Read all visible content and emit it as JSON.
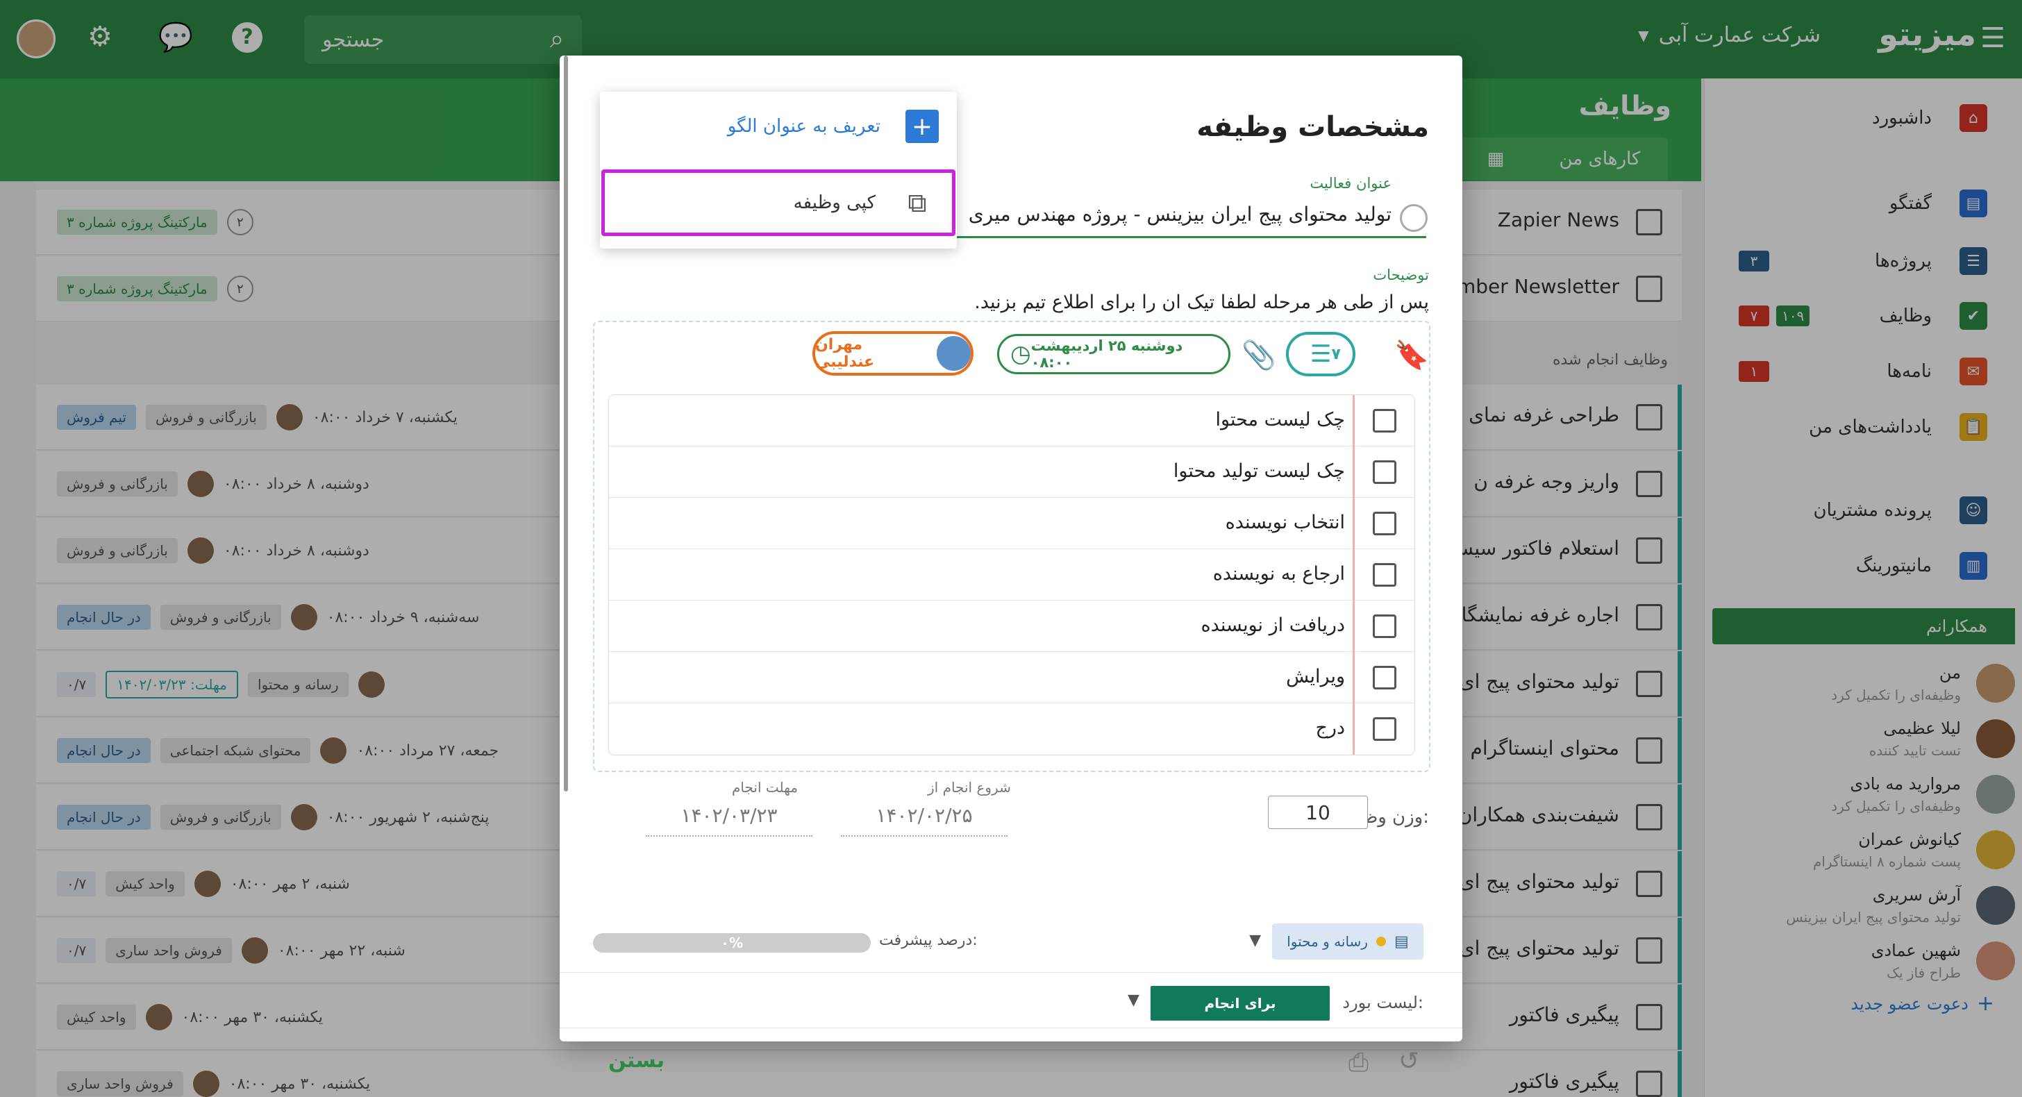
{
  "topbar": {
    "brand": "میزیتو",
    "company": "شرکت عمارت آبی",
    "search_placeholder": "جستجو"
  },
  "page": {
    "title": "وظایف",
    "tab_my_tasks": "کارهای من",
    "done_tasks_label": "وظایف انجام شده"
  },
  "sidebar": {
    "items": [
      {
        "label": "داشبورد",
        "icon": "home-icon",
        "color": "#d8352a"
      },
      {
        "label": "گفتگو",
        "icon": "chat-icon",
        "color": "#2b6cd1"
      },
      {
        "label": "پروژه‌ها",
        "icon": "project-icon",
        "color": "#2d5f8c",
        "badge": "۳"
      },
      {
        "label": "وظایف",
        "icon": "task-check-icon",
        "color": "#2e8b45",
        "badge_red": "۷",
        "badge_green": "۱۰۹"
      },
      {
        "label": "نامه‌ها",
        "icon": "mail-icon",
        "color": "#e8542a",
        "badge_red": "۱"
      },
      {
        "label": "یادداشت‌های من",
        "icon": "clipboard-icon",
        "color": "#e8b21d"
      },
      {
        "label": "پرونده مشتریان",
        "icon": "contact-icon",
        "color": "#2d5f8c"
      },
      {
        "label": "مانیتورینگ",
        "icon": "chart-icon",
        "color": "#2b6cd1"
      }
    ],
    "team_header": "همکارانم",
    "members": [
      {
        "name": "من",
        "status": "وظیفه‌ای را تکمیل کرد"
      },
      {
        "name": "لیلا عظیمی",
        "status": "تست تایید کننده"
      },
      {
        "name": "مروارید مه بادی",
        "status": "وظیفه‌ای را تکمیل کرد"
      },
      {
        "name": "کیانوش عمران",
        "status": "پست شماره ۸ اینستاگرام"
      },
      {
        "name": "آرش سریری",
        "status": "تولید محتوای پیج ایران بیزینس"
      },
      {
        "name": "شهین عمادی",
        "status": "طراح فاز یک"
      }
    ],
    "invite": "دعوت عضو جدید"
  },
  "rows": [
    {
      "title": "Zapier News",
      "tag": "مارکتینگ پروژه شماره ۳",
      "count": "۲"
    },
    {
      "title": "ember Newsletter",
      "tag": "مارکتینگ پروژه شماره ۳",
      "count": "۲"
    },
    {
      "title": "طراحی غرفه نمای",
      "team": "تیم فروش",
      "board": "بازرگانی و فروش",
      "date": "یکشنبه، ۷ خرداد ۰۸:۰۰"
    },
    {
      "title": "واریز وجه غرفه ن",
      "board": "بازرگانی و فروش",
      "date": "دوشنبه، ۸ خرداد ۰۸:۰۰"
    },
    {
      "title": "استعلام فاکتور سیس",
      "board": "بازرگانی و فروش",
      "date": "دوشنبه، ۸ خرداد ۰۸:۰۰"
    },
    {
      "title": "اجاره غرفه نمایشگاه",
      "team": "در حال انجام",
      "board": "بازرگانی و فروش",
      "date": "سه‌شنبه، ۹ خرداد ۰۸:۰۰"
    },
    {
      "title": "تولید محتوای پیج ای",
      "checklist": "۰/۷",
      "deadline": "مهلت: ۱۴۰۲/۰۳/۲۳",
      "board": "رسانه و محتوا"
    },
    {
      "title": "محتوای اینستاگرام",
      "team": "در حال انجام",
      "board": "محتوای شبکه اجتماعی",
      "date": "جمعه، ۲۷ مرداد ۰۸:۰۰"
    },
    {
      "title": "شیفت‌بندی همکاران",
      "team": "در حال انجام",
      "board": "بازرگانی و فروش",
      "date": "پنج‌شنبه، ۲ شهریور ۰۸:۰۰"
    },
    {
      "title": "تولید محتوای پیج ای",
      "checklist": "۰/۷",
      "board": "واحد کیش",
      "date": "شنبه، ۲ مهر ۰۸:۰۰"
    },
    {
      "title": "تولید محتوای پیج ای",
      "checklist": "۰/۷",
      "board": "فروش واحد ساری",
      "date": "شنبه، ۲۲ مهر ۰۸:۰۰"
    },
    {
      "title": "پیگیری فاکتور",
      "board": "واحد کیش",
      "date": "یکشنبه، ۳۰ مهر ۰۸:۰۰"
    },
    {
      "title": "پیگیری فاکتور",
      "board": "فروش واحد ساری",
      "date": "یکشنبه، ۳۰ مهر ۰۸:۰۰"
    }
  ],
  "modal": {
    "title": "مشخصات وظیفه",
    "activity_label": "عنوان فعالیت",
    "activity_value": "تولید محتوای پیج ایران بیزینس - پروژه مهندس میری",
    "description_label": "توضیحات",
    "description_value": "پس از طی هر مرحله لطفا تیک ان را برای اطلاع تیم بزنید.",
    "assignee": "مهران عندلیبی",
    "date_pill": "دوشنبه ۲۵ اردیبهشت ۰۸:۰۰",
    "checklist_count": "۷",
    "checklist": [
      "چک لیست محتوا",
      "چک لیست تولید محتوا",
      "انتخاب نویسنده",
      "ارجاع به نویسنده",
      "دریافت از نویسنده",
      "ویرایش",
      "درج"
    ],
    "due_label": "مهلت انجام",
    "due_value": "۱۴۰۲/۰۳/۲۳",
    "start_label": "شروع انجام از",
    "start_value": "۱۴۰۲/۰۲/۲۵",
    "weight_label": "وزن وظیفه:",
    "weight_value": "10",
    "progress_label": "درصد پیشرفت:",
    "progress_value": "۰%",
    "progress_fraction": 0,
    "board_tag": "رسانه و محتوا",
    "list_label": "لیست بورد:",
    "list_value": "برای انجام",
    "close": "بستن"
  },
  "dropdown": {
    "define_template": "تعریف به عنوان الگو",
    "copy_task": "کپی وظیفه"
  },
  "colors": {
    "brand_green": "#2e8b45",
    "teal": "#2aa9a2",
    "orange": "#e86e1d",
    "highlight": "#cc22dd"
  }
}
